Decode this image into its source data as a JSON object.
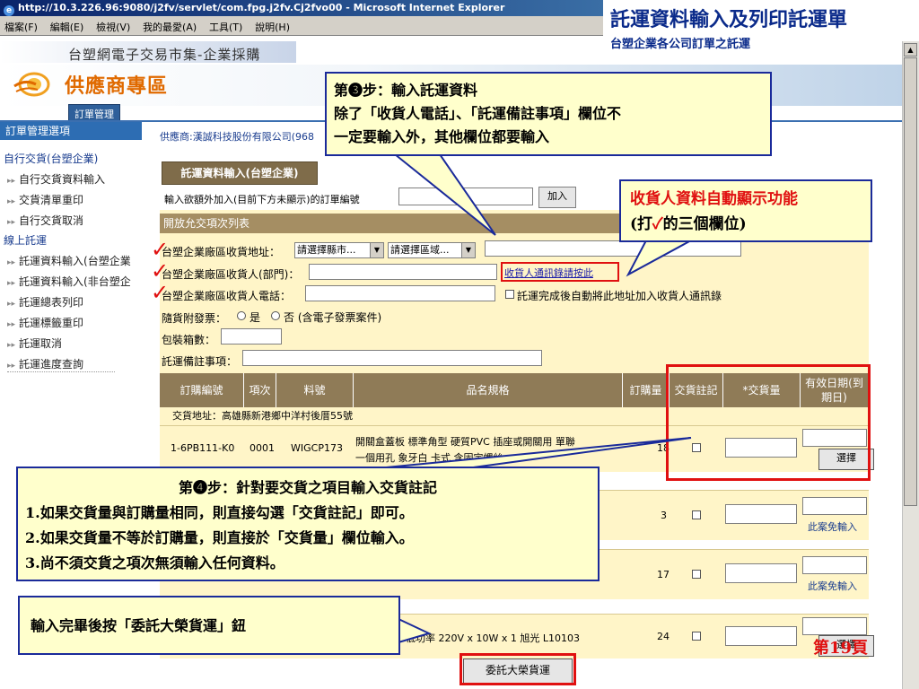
{
  "window": {
    "title": "http://10.3.226.96:9080/j2fv/servlet/com.fpg.j2fv.Cj2fvo00 - Microsoft Internet Explorer",
    "menu": [
      "檔案(F)",
      "編輯(E)",
      "檢視(V)",
      "我的最愛(A)",
      "工具(T)",
      "說明(H)"
    ]
  },
  "slide": {
    "title": "託運資料輸入及列印託運單",
    "subtitle": "台塑企業各公司訂單之託運",
    "page_number": "第19頁"
  },
  "site": {
    "name": "台塑網電子交易市集-企業採購",
    "logo_text": "供應商專區",
    "tab": "訂單管理"
  },
  "sidebar": {
    "header": "訂單管理選項",
    "sections": [
      {
        "title": "自行交貨(台塑企業)",
        "items": [
          "自行交貨資料輸入",
          "交貨清單重印",
          "自行交貨取消"
        ]
      },
      {
        "title": "線上託運",
        "items": [
          "託運資料輸入(台塑企業",
          "託運資料輸入(非台塑企",
          "託運總表列印",
          "託運標籤重印",
          "託運取消",
          "託運進度查詢"
        ]
      }
    ]
  },
  "vendor": "供應商:漢誠科技股份有限公司(968",
  "form": {
    "tab_title": "託運資料輸入(台塑企業)",
    "add_label": "輸入欲額外加入(目前下方未顯示)的訂單編號",
    "add_button": "加入",
    "open_bar": "開放允交項次列表",
    "address_label": "台塑企業廠區收貨地址：",
    "city_select": "請選擇縣市...",
    "district_select": "請選擇區域...",
    "receiver_label": "台塑企業廠區收貨人(部門)：",
    "contact_link": "收貨人通訊錄請按此",
    "phone_label": "台塑企業廠區收貨人電話：",
    "auto_add_label": "託運完成後自動將此地址加入收貨人通訊錄",
    "invoice_label": "隨貨附發票：",
    "invoice_yes": "是",
    "invoice_no": "否 (含電子發票案件)",
    "boxes_label": "包裝箱數：",
    "notes_label": "託運備註事項："
  },
  "table": {
    "headers": [
      "訂購編號",
      "項次",
      "料號",
      "品名規格",
      "訂購量",
      "交貨註記",
      "*交貨量",
      "有效日期(到期日)"
    ],
    "delivery_address": "交貨地址：高雄縣新港鄉中洋村後厝55號",
    "rows": [
      {
        "order_no": "1-6PB111-K0",
        "item": "0001",
        "part_no": "WIGCP173",
        "desc_line1": "開關盒蓋板 標準角型 硬質PVC 插座或開關用 單聯",
        "desc_line2": "一個用孔 象牙白 卡式 含固定螺絲",
        "qty": "18",
        "date_action": "選擇"
      },
      {
        "order_no": "",
        "item": "",
        "part_no": "",
        "desc_line1": "",
        "desc_line2": "",
        "qty": "3",
        "date_action": "此案免輸入"
      },
      {
        "order_no": "",
        "item": "",
        "part_no": "",
        "desc_line1": "",
        "desc_line2": "",
        "qty": "17",
        "date_action": "此案免輸入"
      },
      {
        "order_no": "",
        "item": "",
        "part_no": "",
        "desc_line1": "低功率 220V x 10W x 1 旭光 L10103",
        "desc_line2": "",
        "qty": "24",
        "date_action": "選擇"
      }
    ],
    "submit_button": "委託大榮貨運"
  },
  "callouts": {
    "step3_title": "第❸步：輸入託運資料",
    "step3_line1": "除了「收貨人電話」、「託運備註事項」欄位不",
    "step3_line2": "一定要輸入外，其他欄位都要輸入",
    "auto_line1": "收貨人資料自動顯示功能",
    "auto_line2_a": "(打",
    "auto_check": "✓",
    "auto_line2_b": "的三個欄位)",
    "step4_title": "第❹步：針對要交貨之項目輸入交貨註記",
    "step4_line1": "1.如果交貨量與訂購量相同，則直接勾選「交貨註記」即可。",
    "step4_line2": "2.如果交貨量不等於訂購量，則直接於「交貨量」欄位輸入。",
    "step4_line3": "3.尚不須交貨之項次無須輸入任何資料。",
    "step5": "輸入完畢後按「委託大榮貨運」鈕"
  },
  "colors": {
    "accent_red": "#e01010",
    "callout_border": "#1a2a9a",
    "callout_fill": "#ffffcc",
    "form_fill": "#fff5c8",
    "table_header": "#8f7b57",
    "logo_orange": "#e06a00"
  }
}
